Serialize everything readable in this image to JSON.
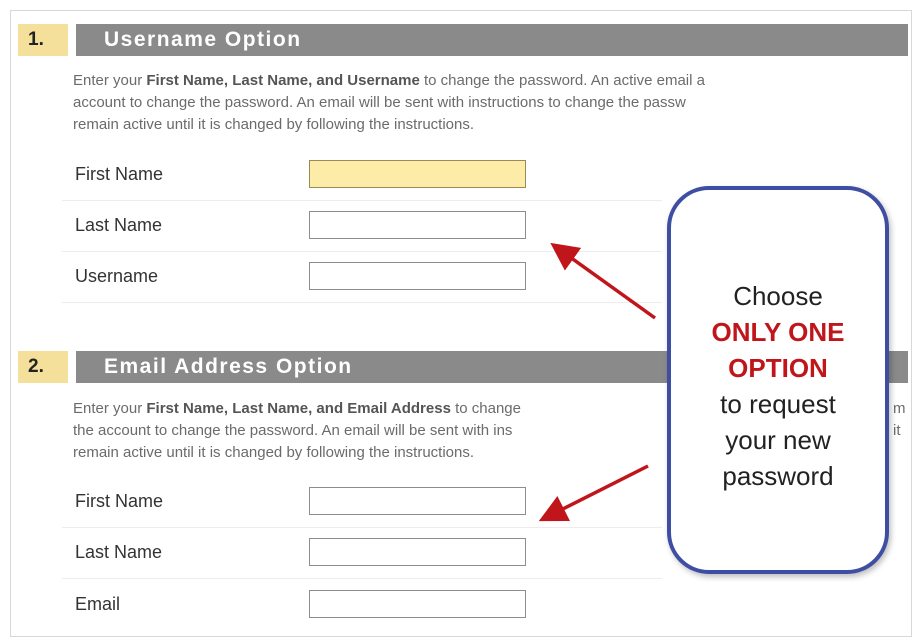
{
  "section1": {
    "number": "1.",
    "title": "Username Option",
    "desc_line1_pre": "Enter your ",
    "desc_line1_bold": "First Name, Last Name, and Username",
    "desc_line1_post": " to change the password. An active email a",
    "desc_line2": "account to change the password. An email will be sent with instructions to change the passw",
    "desc_line3": "remain active until it is changed by following the instructions.",
    "fields": [
      {
        "label": "First Name",
        "value": ""
      },
      {
        "label": "Last Name",
        "value": ""
      },
      {
        "label": "Username",
        "value": ""
      }
    ]
  },
  "section2": {
    "number": "2.",
    "title": "Email Address Option",
    "desc_line1_pre": "Enter your ",
    "desc_line1_bold": "First Name, Last Name, and Email Address",
    "desc_line1_post": " to change",
    "desc_line1_tail": "m",
    "desc_line2": "the account to change the password. An email will be sent with ins",
    "desc_line2_tail": "it",
    "desc_line3": "remain active until it is changed by following the instructions.",
    "fields": [
      {
        "label": "First Name",
        "value": ""
      },
      {
        "label": "Last Name",
        "value": ""
      },
      {
        "label": "Email",
        "value": ""
      }
    ]
  },
  "callout": {
    "line1": "Choose",
    "line2": "ONLY ONE",
    "line3": "OPTION",
    "line4": "to request",
    "line5": "your new",
    "line6": "password"
  },
  "colors": {
    "section_number_bg": "#f4df9b",
    "section_title_bg": "#8a8a8a",
    "callout_border": "#3e4fa3",
    "callout_emphasis": "#c0161b",
    "arrow": "#c0161b",
    "focused_input_bg": "#fdeba8"
  }
}
